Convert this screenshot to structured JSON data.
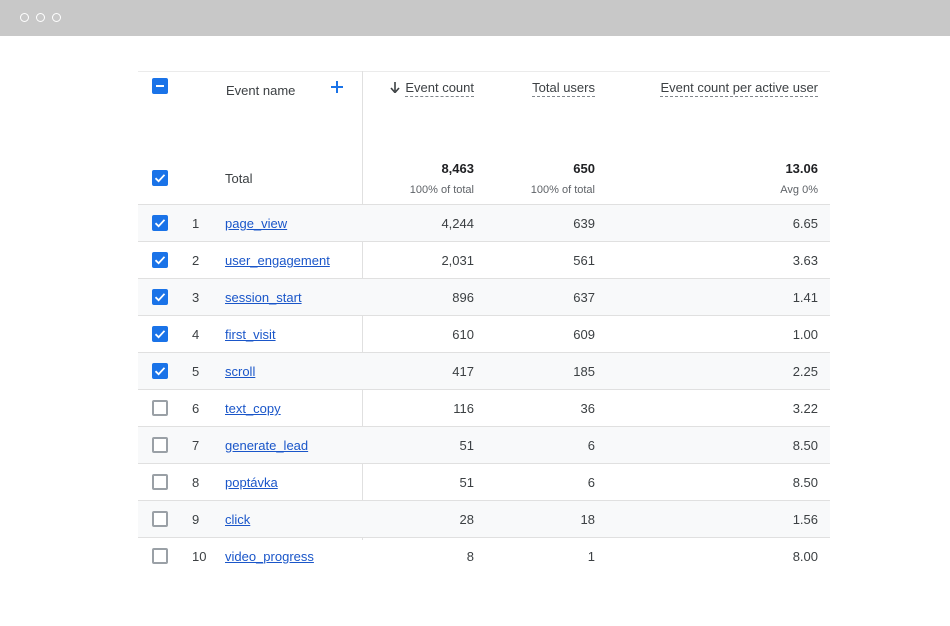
{
  "window": {
    "dot_color": "#ffffff"
  },
  "colors": {
    "accent": "#1a73e8",
    "link": "#1a56c9"
  },
  "header": {
    "event_name": "Event name",
    "event_count": "Event count",
    "total_users": "Total users",
    "event_count_per_user": "Event count per active user",
    "add_icon": "plus-icon",
    "sort_icon": "arrow-down-icon"
  },
  "total": {
    "label": "Total",
    "event_count": "8,463",
    "event_count_sub": "100% of total",
    "total_users": "650",
    "total_users_sub": "100% of total",
    "per_user": "13.06",
    "per_user_sub": "Avg 0%"
  },
  "rows": [
    {
      "idx": "1",
      "name": "page_view",
      "count": "4,244",
      "users": "639",
      "per": "6.65",
      "checked": true
    },
    {
      "idx": "2",
      "name": "user_engagement",
      "count": "2,031",
      "users": "561",
      "per": "3.63",
      "checked": true
    },
    {
      "idx": "3",
      "name": "session_start",
      "count": "896",
      "users": "637",
      "per": "1.41",
      "checked": true
    },
    {
      "idx": "4",
      "name": "first_visit",
      "count": "610",
      "users": "609",
      "per": "1.00",
      "checked": true
    },
    {
      "idx": "5",
      "name": "scroll",
      "count": "417",
      "users": "185",
      "per": "2.25",
      "checked": true
    },
    {
      "idx": "6",
      "name": "text_copy",
      "count": "116",
      "users": "36",
      "per": "3.22",
      "checked": false
    },
    {
      "idx": "7",
      "name": "generate_lead",
      "count": "51",
      "users": "6",
      "per": "8.50",
      "checked": false
    },
    {
      "idx": "8",
      "name": "poptávka",
      "count": "51",
      "users": "6",
      "per": "8.50",
      "checked": false
    },
    {
      "idx": "9",
      "name": "click",
      "count": "28",
      "users": "18",
      "per": "1.56",
      "checked": false
    },
    {
      "idx": "10",
      "name": "video_progress",
      "count": "8",
      "users": "1",
      "per": "8.00",
      "checked": false
    }
  ]
}
